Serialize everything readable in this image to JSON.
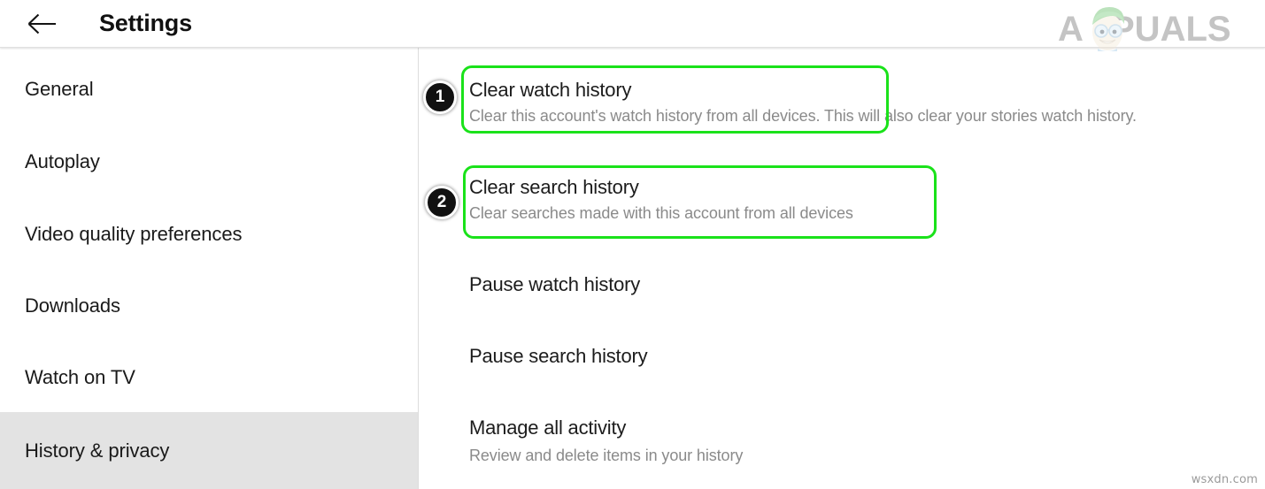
{
  "header": {
    "title": "Settings",
    "back_icon": "arrow-left-icon",
    "logo_text": "APPUALS",
    "logo_colors": {
      "text": "#6d6d6d",
      "hair": "#57b85a",
      "skin": "#f3e7d2",
      "glasses": "#9ec9e8"
    }
  },
  "sidebar": {
    "items": [
      {
        "label": "General",
        "selected": false
      },
      {
        "label": "Autoplay",
        "selected": false
      },
      {
        "label": "Video quality preferences",
        "selected": false
      },
      {
        "label": "Downloads",
        "selected": false
      },
      {
        "label": "Watch on TV",
        "selected": false
      },
      {
        "label": "History & privacy",
        "selected": true
      }
    ],
    "selected_bg": "#e3e3e3"
  },
  "main": {
    "rows": [
      {
        "title": "Clear watch history",
        "subtitle": "Clear this account's watch history from all devices. This will also clear your stories watch history.",
        "highlighted": true,
        "step": "1"
      },
      {
        "title": "Clear search history",
        "subtitle": "Clear searches made with this account from all devices",
        "highlighted": true,
        "step": "2"
      },
      {
        "title": "Pause watch history",
        "subtitle": "",
        "highlighted": false,
        "step": ""
      },
      {
        "title": "Pause search history",
        "subtitle": "",
        "highlighted": false,
        "step": ""
      },
      {
        "title": "Manage all activity",
        "subtitle": "Review and delete items in your history",
        "highlighted": false,
        "step": ""
      }
    ],
    "highlight_color": "#1ae21a",
    "badge_bg": "#111111",
    "badge_fg": "#ffffff"
  },
  "watermark": {
    "bottom_right": "wsxdn.com"
  }
}
